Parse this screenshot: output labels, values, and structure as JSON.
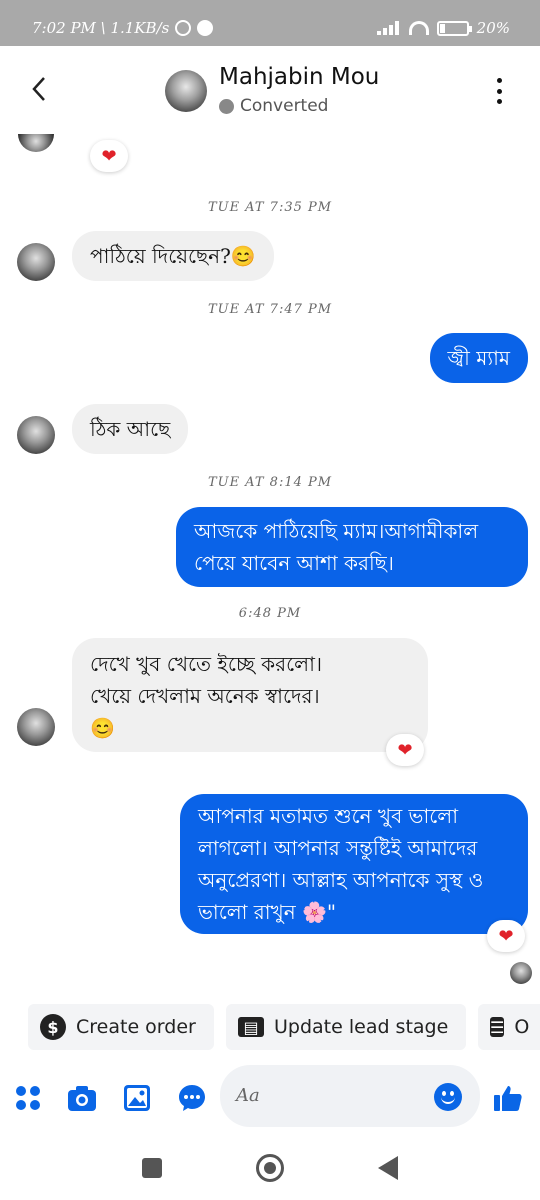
{
  "status_bar": {
    "time_speed": "7:02 PM \\ 1.1KB/s",
    "battery": "20%",
    "battery_level": 0.2
  },
  "header": {
    "contact_name": "Mahjabin Mou",
    "status": "Converted",
    "back_icon": "chevron-left-icon",
    "more_icon": "vertical-dots-icon"
  },
  "messages": [
    {
      "timestamp": "TUE AT 7:35 PM"
    },
    {
      "from": "in",
      "text": "পাঠিয়ে দিয়েছেন?😊"
    },
    {
      "timestamp": "TUE AT 7:47 PM"
    },
    {
      "from": "out",
      "text": "জ্বী ম্যাম"
    },
    {
      "from": "in",
      "text": "ঠিক আছে"
    },
    {
      "timestamp": "TUE AT 8:14 PM"
    },
    {
      "from": "out",
      "lines": [
        "আজকে পাঠিয়েছি ম্যাম।আগামীকাল",
        "পেয়ে যাবেন আশা করছি।"
      ]
    },
    {
      "timestamp": "6:48 PM"
    },
    {
      "from": "in",
      "lines": [
        "দেখে খুব খেতে ইচ্ছে করলো।",
        "খেয়ে দেখলাম অনেক স্বাদের।",
        "😊"
      ],
      "reaction": "❤"
    },
    {
      "from": "out",
      "lines": [
        "আপনার মতামত শুনে খুব ভালো",
        "লাগলো। আপনার সন্তুষ্টিই আমাদের",
        "অনুপ্রেরণা। আল্লাহ আপনাকে সুস্থ ও",
        "ভালো রাখুন 🌸\""
      ],
      "reaction": "❤"
    }
  ],
  "top_reaction": "❤",
  "quick_actions": [
    {
      "label": "Create order",
      "icon": "dollar-icon"
    },
    {
      "label": "Update lead stage",
      "icon": "id-card-icon"
    },
    {
      "label": "O",
      "icon": "list-icon"
    }
  ],
  "composer": {
    "placeholder": "Aa",
    "icons": [
      "apps-icon",
      "camera-icon",
      "image-icon",
      "chat-more-icon",
      "emoji-icon",
      "thumbs-up-icon"
    ]
  },
  "colors": {
    "outgoing": "#0a63e8",
    "incoming": "#f0f0f0",
    "accent": "#0a66e6",
    "reaction": "#e0222a"
  }
}
